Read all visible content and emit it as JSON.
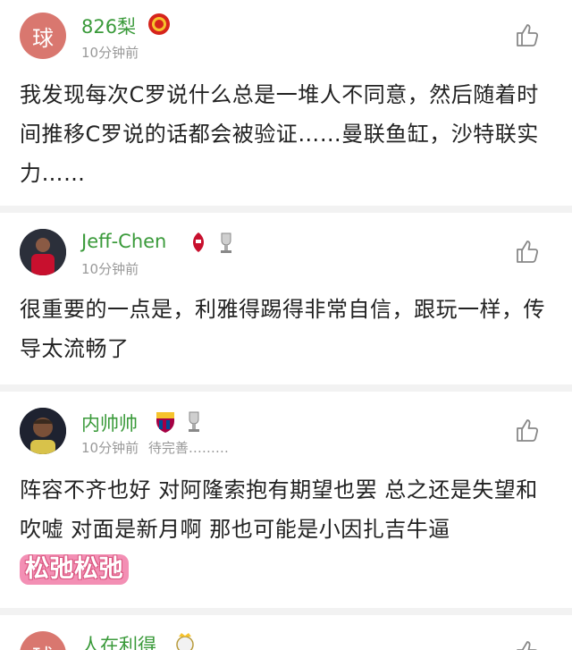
{
  "comments": [
    {
      "avatar_text": "球",
      "username": "826梨",
      "badges": [
        "manchester-united-crest"
      ],
      "time": "10分钟前",
      "body": "我发现每次C罗说什么总是一堆人不同意，然后随着时间推移C罗说的话都会被验证……曼联鱼缸，沙特联实力……"
    },
    {
      "avatar_text": "",
      "username": "Jeff-Chen",
      "badges": [
        "liverpool-crest",
        "trophy-icon"
      ],
      "time": "10分钟前",
      "body": "很重要的一点是，利雅得踢得非常自信，跟玩一样，传导太流畅了"
    },
    {
      "avatar_text": "",
      "username": "内帅帅",
      "badges": [
        "barcelona-crest",
        "trophy-icon"
      ],
      "time": "10分钟前",
      "extra": "待完善………",
      "body": "阵容不齐也好 对阿隆索抱有期望也罢 总之还是失望和吹嘘 对面是新月啊 那也可能是小因扎吉牛逼",
      "sticker": "松弛松弛"
    },
    {
      "avatar_text": "球",
      "username": "人在利得",
      "badges": [
        "real-madrid-crest"
      ]
    }
  ],
  "colors": {
    "username": "#3a9a3a",
    "meta": "#999999",
    "avatar_bg": "#d9776f",
    "divider": "#f2f2f2"
  },
  "icons": {
    "like": "thumbs-up-icon"
  }
}
